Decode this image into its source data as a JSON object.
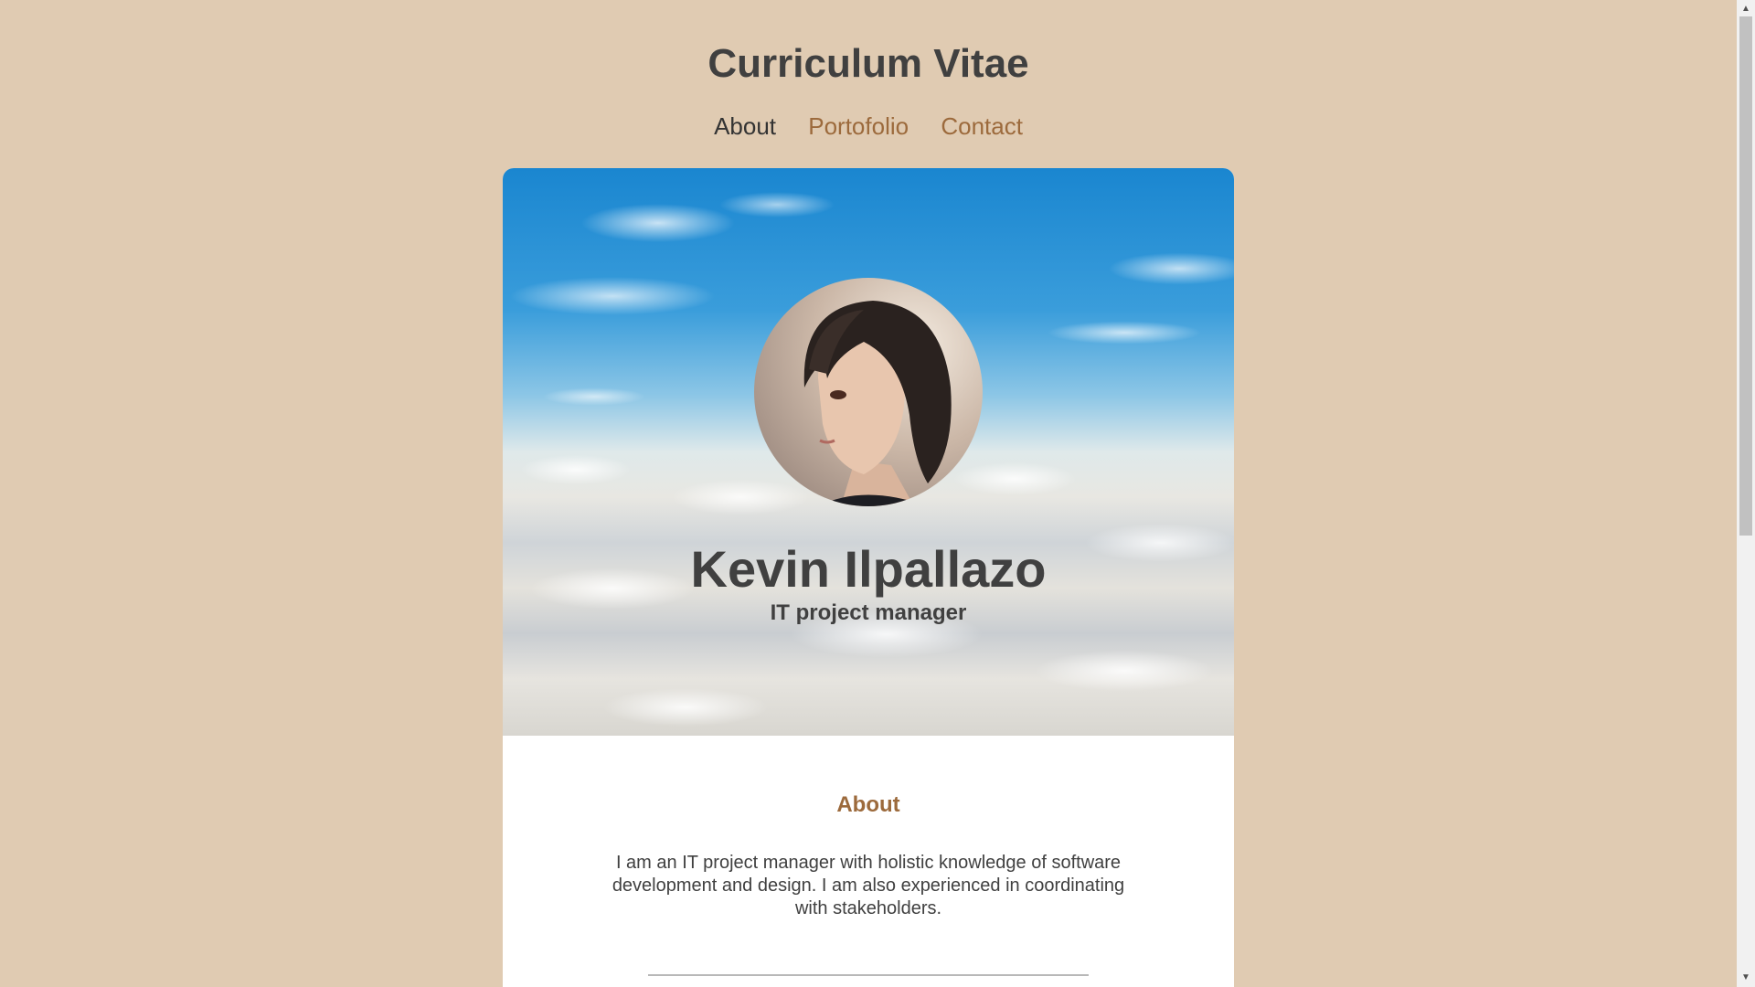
{
  "site": {
    "title": "Curriculum Vitae"
  },
  "nav": {
    "items": [
      {
        "label": "About",
        "active": true
      },
      {
        "label": "Portofolio",
        "active": false
      },
      {
        "label": "Contact",
        "active": false
      }
    ]
  },
  "profile": {
    "name": "Kevin Ilpallazo",
    "role": "IT project manager"
  },
  "about": {
    "heading": "About",
    "text": "I am an IT project manager with holistic knowledge of software development and design. I am also experienced in coordinating with stakeholders."
  },
  "colors": {
    "background": "#e0cbb2",
    "accent": "#9c6a3c",
    "text": "#404040"
  }
}
